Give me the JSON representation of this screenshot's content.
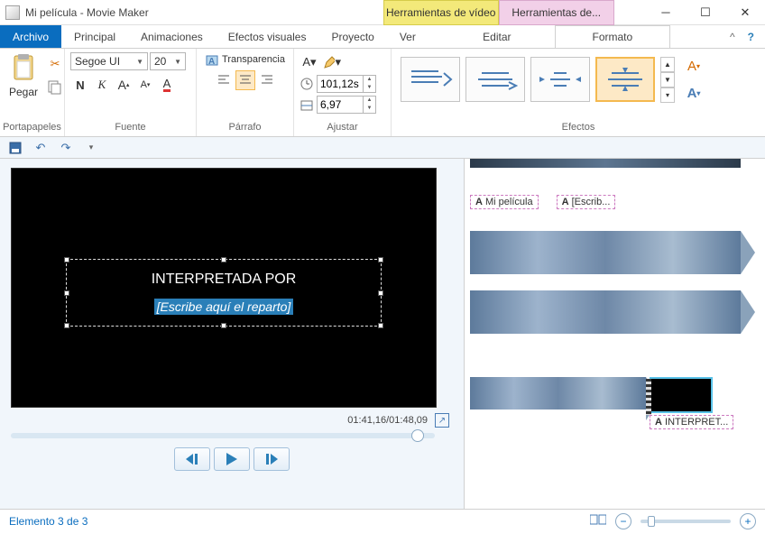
{
  "window": {
    "title": "Mi película - Movie Maker"
  },
  "context_tabs": {
    "video": "Herramientas de vídeo",
    "text": "Herramientas de..."
  },
  "menu": {
    "file": "Archivo",
    "home": "Principal",
    "anim": "Animaciones",
    "vfx": "Efectos visuales",
    "project": "Proyecto",
    "view": "Ver",
    "edit": "Editar",
    "format": "Formato"
  },
  "ribbon": {
    "clipboard": {
      "paste": "Pegar",
      "label": "Portapapeles"
    },
    "font": {
      "family": "Segoe UI",
      "size": "20",
      "transparency": "Transparencia",
      "label": "Fuente"
    },
    "paragraph": {
      "label": "Párrafo"
    },
    "adjust": {
      "start_time": "101,12s",
      "duration": "6,97",
      "label": "Ajustar"
    },
    "effects": {
      "label": "Efectos"
    }
  },
  "preview": {
    "title_text": "INTERPRETADA POR",
    "placeholder_text": "[Escribe aquí el reparto]",
    "time": "01:41,16/01:48,09"
  },
  "timeline": {
    "label1": "Mi película",
    "label2": "[Escrib...",
    "label3": "INTERPRET..."
  },
  "status": {
    "text": "Elemento 3 de 3"
  }
}
